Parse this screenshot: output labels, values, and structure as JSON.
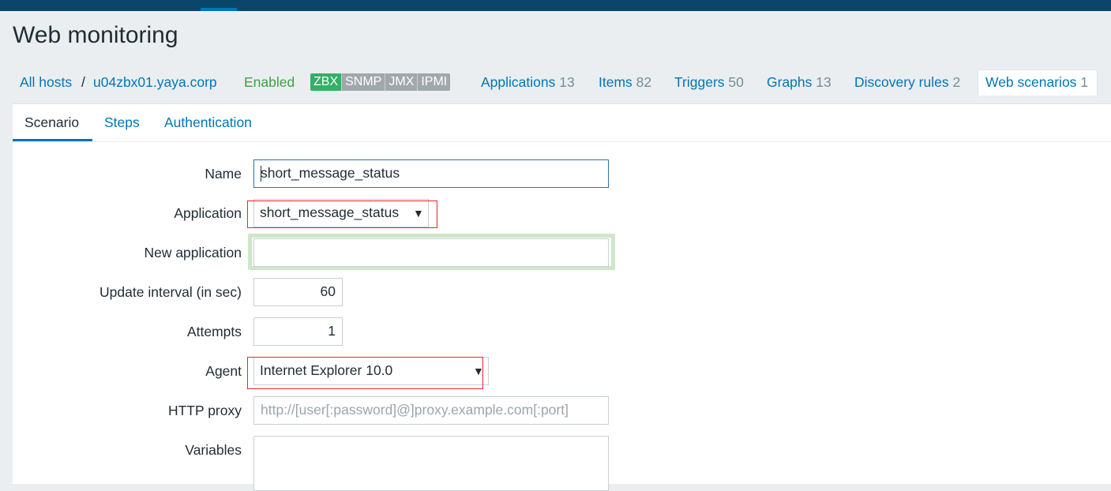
{
  "page": {
    "title": "Web monitoring"
  },
  "breadcrumb": {
    "all_hosts": "All hosts",
    "separator": "/",
    "host": "u04zbx01.yaya.corp"
  },
  "status": {
    "enabled": "Enabled"
  },
  "availability": [
    "ZBX",
    "SNMP",
    "JMX",
    "IPMI"
  ],
  "host_nav": [
    {
      "label": "Applications",
      "count": "13"
    },
    {
      "label": "Items",
      "count": "82"
    },
    {
      "label": "Triggers",
      "count": "50"
    },
    {
      "label": "Graphs",
      "count": "13"
    },
    {
      "label": "Discovery rules",
      "count": "2"
    },
    {
      "label": "Web scenarios",
      "count": "1"
    }
  ],
  "tabs": [
    "Scenario",
    "Steps",
    "Authentication"
  ],
  "form": {
    "name": {
      "label": "Name",
      "value": "short_message_status"
    },
    "application": {
      "label": "Application",
      "value": "short_message_status",
      "arrow": "▼"
    },
    "new_application": {
      "label": "New application",
      "value": ""
    },
    "update_interval": {
      "label": "Update interval (in sec)",
      "value": "60"
    },
    "attempts": {
      "label": "Attempts",
      "value": "1"
    },
    "agent": {
      "label": "Agent",
      "value": "Internet Explorer 10.0",
      "arrow": "▼"
    },
    "http_proxy": {
      "label": "HTTP proxy",
      "placeholder": "http://[user[:password]@]proxy.example.com[:port]"
    },
    "variables": {
      "label": "Variables",
      "value": ""
    }
  },
  "colors": {
    "link": "#0275b8",
    "enabled": "#429e47",
    "zbx_tag": "#34af67",
    "tag_grey": "#a0a8ac",
    "highlight_red": "#e8262c",
    "highlight_green": "#cfe6c9",
    "topbar": "#0a466a"
  }
}
